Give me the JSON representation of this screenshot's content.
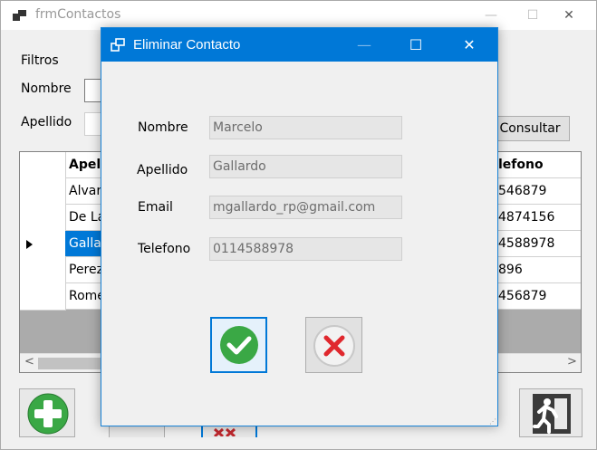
{
  "main_window": {
    "title": "frmContactos",
    "controls": {
      "minimize": "—",
      "maximize": "☐",
      "close": "✕"
    },
    "filters_label": "Filtros",
    "nombre_label": "Nombre",
    "apellido_label": "Apellido",
    "consultar_label": "Consultar"
  },
  "grid": {
    "columns": [
      "Apel",
      "lefono"
    ],
    "rows": [
      {
        "apellido": "Alvar",
        "telefono": "546879",
        "selected": false
      },
      {
        "apellido": "De La",
        "telefono": "4874156",
        "selected": false
      },
      {
        "apellido": "Galla",
        "telefono": "4588978",
        "selected": true
      },
      {
        "apellido": "Perez",
        "telefono": "896",
        "selected": false
      },
      {
        "apellido": "Rome",
        "telefono": "456879",
        "selected": false
      }
    ],
    "scroll_left": "<",
    "scroll_right": ">"
  },
  "dialog": {
    "title": "Eliminar Contacto",
    "controls": {
      "minimize": "—",
      "maximize": "☐",
      "close": "✕"
    },
    "fields": [
      {
        "label": "Nombre",
        "value": "Marcelo"
      },
      {
        "label": "Apellido",
        "value": "Gallardo"
      },
      {
        "label": "Email",
        "value": "mgallardo_rp@gmail.com"
      },
      {
        "label": "Telefono",
        "value": "0114588978"
      }
    ],
    "confirm_icon": "check-icon",
    "cancel_icon": "x-icon"
  },
  "colors": {
    "dialog_title_bg": "#0078d7",
    "selection": "#0078d7",
    "confirm_green": "#3aa845",
    "cancel_red": "#e0282e"
  }
}
